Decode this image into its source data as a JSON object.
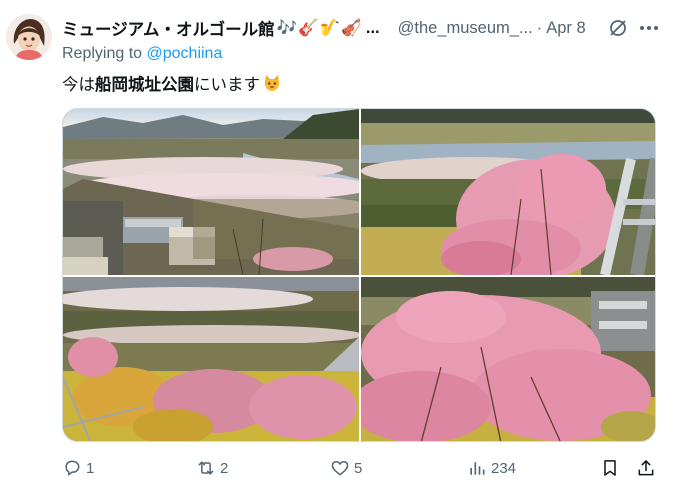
{
  "tweet": {
    "display_name": "ミュージアム・オルゴール館",
    "name_emojis": [
      "🎶",
      "🎸",
      "🎷",
      "🎻"
    ],
    "name_truncation": "...",
    "handle": "@the_museum_...",
    "separator": "·",
    "date": "Apr 8",
    "replying_prefix": "Replying to ",
    "replying_to": "@pochiina",
    "text_before": "今は",
    "text_highlight": "船岡城址公園",
    "text_after": "にいます",
    "text_emoji": "cat-face",
    "photos": [
      {
        "alt": "aerial view of town and cherry blossom riverside"
      },
      {
        "alt": "pink blossoms over river and slide"
      },
      {
        "alt": "cherry trees and yellow flowers on slope"
      },
      {
        "alt": "pink blossoms close-up over valley"
      }
    ]
  },
  "actions": {
    "reply_count": "1",
    "retweet_count": "2",
    "like_count": "5",
    "views_count": "234"
  },
  "icons": {
    "reply": "reply-icon",
    "retweet": "retweet-icon",
    "like": "heart-icon",
    "views": "views-icon",
    "bookmark": "bookmark-icon",
    "share": "share-icon",
    "grok": "grok-icon",
    "more": "more-icon"
  },
  "colors": {
    "text": "#0f1419",
    "muted": "#536471",
    "link": "#1d9bf0",
    "border": "#cfd9de"
  }
}
